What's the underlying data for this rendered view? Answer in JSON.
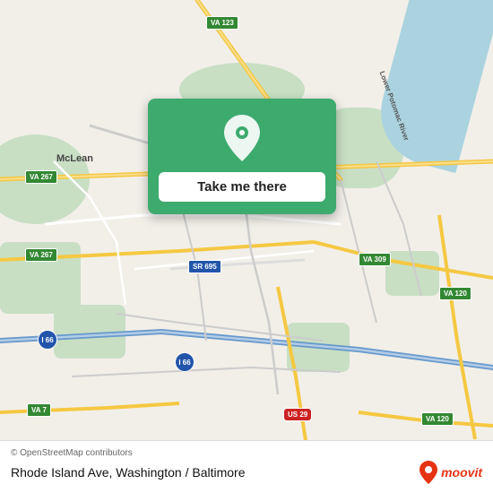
{
  "map": {
    "background_color": "#f2efe9",
    "center_label": "Take me there",
    "copyright": "© OpenStreetMap contributors",
    "location_name": "Rhode Island Ave, Washington / Baltimore"
  },
  "popup": {
    "button_label": "Take me there",
    "icon": "location-pin-icon"
  },
  "labels": {
    "va123": "VA 123",
    "va267_top": "VA 267",
    "va267_mid": "VA 267",
    "sr695": "SR 695",
    "va309": "VA 309",
    "va120_right": "VA 120",
    "va120_bottom": "VA 120",
    "va7": "VA 7",
    "i66_left": "I 66",
    "i66_bottom": "I 66",
    "us29": "US 29",
    "mclean": "McLean",
    "lower_potomac": "Lower Potomac River"
  },
  "moovit": {
    "text": "moovit"
  }
}
